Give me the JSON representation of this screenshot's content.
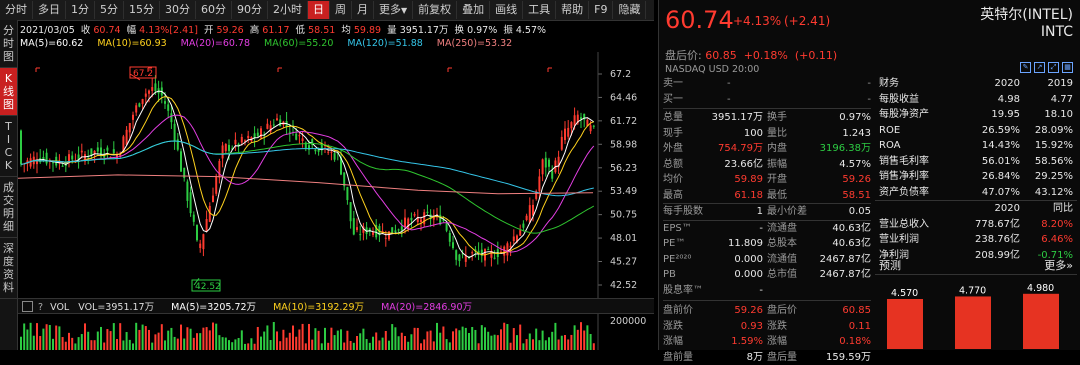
{
  "toolbar": {
    "periods": [
      "分时",
      "多日",
      "1分",
      "5分",
      "15分",
      "30分",
      "60分",
      "90分",
      "2小时",
      "日",
      "周",
      "月"
    ],
    "active_period": "日",
    "more": "更多",
    "adjust": "前复权",
    "overlay": "叠加",
    "draw": "画线",
    "tools": "工具",
    "help": "帮助",
    "f9": "F9",
    "hide": "隐藏"
  },
  "leftnav": [
    "分时图",
    "K线图",
    "TICK",
    "成交明细",
    "深度资料"
  ],
  "infoline": {
    "date": "2021/03/05",
    "close_label": "收",
    "close": "60.74",
    "change_label": "幅",
    "change": "4.13%[2.41]",
    "open_label": "开",
    "open": "59.26",
    "high_label": "高",
    "high": "61.17",
    "low_label": "低",
    "low": "58.51",
    "avg_label": "均",
    "avg": "59.89",
    "vol_label": "量",
    "vol": "3951.17万",
    "turn_label": "换",
    "turn": "0.97%",
    "amp_label": "振",
    "amp": "4.57%"
  },
  "ma": [
    {
      "label": "MA(5)=60.62",
      "color": "#ffffff"
    },
    {
      "label": "MA(10)=60.93",
      "color": "#ffd21e"
    },
    {
      "label": "MA(20)=60.78",
      "color": "#e23ee2"
    },
    {
      "label": "MA(60)=55.20",
      "color": "#2fc42f"
    },
    {
      "label": "MA(120)=51.88",
      "color": "#35c5e8"
    },
    {
      "label": "MA(250)=53.32",
      "color": "#f08080"
    }
  ],
  "yaxis": [
    "67.2",
    "64.46",
    "61.72",
    "58.98",
    "56.23",
    "53.49",
    "50.75",
    "48.01",
    "45.27",
    "42.52"
  ],
  "annotations": {
    "high": "67.2",
    "low": "42.52"
  },
  "volline": {
    "vol_label": "VOL",
    "vol": "VOL=3951.17万",
    "ma5": "MA(5)=3205.72万",
    "ma10": "MA(10)=3192.29万",
    "ma20": "MA(20)=2846.90万"
  },
  "vol_axis": "200000",
  "quote": {
    "price": "60.74",
    "pct": "+4.13%",
    "chg": "(+2.41)",
    "name": "英特尔(INTEL)",
    "ticker": "INTC",
    "after_label": "盘后价:",
    "after_price": "60.85",
    "after_pct": "+0.18%",
    "after_chg": "(+0.11)",
    "market": "NASDAQ",
    "currency": "USD",
    "time": "20:00"
  },
  "orderbook": [
    {
      "label": "卖一",
      "v1": "-",
      "v2": "-"
    },
    {
      "label": "买一",
      "v1": "-",
      "v2": "-"
    }
  ],
  "stats": [
    {
      "l1": "总量",
      "v1": "3951.17万",
      "l2": "换手",
      "v2": "0.97%",
      "c1": "white",
      "c2": "white"
    },
    {
      "l1": "现手",
      "v1": "100",
      "l2": "量比",
      "v2": "1.243",
      "c1": "white",
      "c2": "white"
    },
    {
      "l1": "外盘",
      "v1": "754.79万",
      "l2": "内盘",
      "v2": "3196.38万",
      "c1": "red",
      "c2": "green"
    },
    {
      "l1": "总额",
      "v1": "23.66亿",
      "l2": "振幅",
      "v2": "4.57%",
      "c1": "white",
      "c2": "white"
    },
    {
      "l1": "均价",
      "v1": "59.89",
      "l2": "开盘",
      "v2": "59.26",
      "c1": "red",
      "c2": "red"
    },
    {
      "l1": "最高",
      "v1": "61.18",
      "l2": "最低",
      "v2": "58.51",
      "c1": "red",
      "c2": "red"
    },
    {
      "l1": "每手股数",
      "v1": "1",
      "l2": "最小价差",
      "v2": "0.05",
      "c1": "white",
      "c2": "white"
    },
    {
      "l1": "EPS™",
      "v1": "-",
      "l2": "流通盘",
      "v2": "40.63亿",
      "c1": "white",
      "c2": "white"
    },
    {
      "l1": "PE™",
      "v1": "11.809",
      "l2": "总股本",
      "v2": "40.63亿",
      "c1": "white",
      "c2": "white"
    },
    {
      "l1": "PE²⁰²⁰",
      "v1": "0.000",
      "l2": "流通值",
      "v2": "2467.87亿",
      "c1": "white",
      "c2": "white"
    },
    {
      "l1": "PB",
      "v1": "0.000",
      "l2": "总市值",
      "v2": "2467.87亿",
      "c1": "white",
      "c2": "white"
    },
    {
      "l1": "股息率™",
      "v1": "-",
      "l2": "",
      "v2": "",
      "c1": "white",
      "c2": "white"
    }
  ],
  "after_stats": [
    {
      "l1": "盘前价",
      "v1": "59.26",
      "l2": "盘后价",
      "v2": "60.85",
      "c1": "red",
      "c2": "red"
    },
    {
      "l1": "涨跌",
      "v1": "0.93",
      "l2": "涨跌",
      "v2": "0.11",
      "c1": "red",
      "c2": "red"
    },
    {
      "l1": "涨幅",
      "v1": "1.59%",
      "l2": "涨幅",
      "v2": "0.18%",
      "c1": "red",
      "c2": "red"
    },
    {
      "l1": "盘前量",
      "v1": "8万",
      "l2": "盘后量",
      "v2": "159.59万",
      "c1": "white",
      "c2": "white"
    }
  ],
  "finance": {
    "header": [
      "财务",
      "2020",
      "2019"
    ],
    "rows": [
      {
        "label": "每股收益",
        "a": "4.98",
        "b": "4.77",
        "c": "white"
      },
      {
        "label": "每股净资产",
        "a": "19.95",
        "b": "18.10",
        "c": "white"
      },
      {
        "label": "ROE",
        "a": "26.59%",
        "b": "28.09%",
        "c": "white"
      },
      {
        "label": "ROA",
        "a": "14.43%",
        "b": "15.92%",
        "c": "white"
      },
      {
        "label": "销售毛利率",
        "a": "56.01%",
        "b": "58.56%",
        "c": "white"
      },
      {
        "label": "销售净利率",
        "a": "26.84%",
        "b": "29.25%",
        "c": "white"
      },
      {
        "label": "资产负债率",
        "a": "47.07%",
        "b": "43.12%",
        "c": "white"
      }
    ],
    "header2": [
      "",
      "2020",
      "同比"
    ],
    "rows2": [
      {
        "label": "营业总收入",
        "a": "778.67亿",
        "b": "8.20%",
        "c": "red"
      },
      {
        "label": "营业利润",
        "a": "238.76亿",
        "b": "6.46%",
        "c": "red"
      },
      {
        "label": "净利润",
        "a": "208.99亿",
        "b": "-0.71%",
        "c": "green"
      }
    ]
  },
  "forecast": {
    "title": "预测",
    "more": "更多»",
    "bars": [
      {
        "label": "4.570",
        "value": 4.57
      },
      {
        "label": "4.770",
        "value": 4.77
      },
      {
        "label": "4.980",
        "value": 4.98
      }
    ]
  },
  "colors": {
    "up": "#ff3b30",
    "down": "#2dcc43",
    "accent": "#c92020"
  }
}
